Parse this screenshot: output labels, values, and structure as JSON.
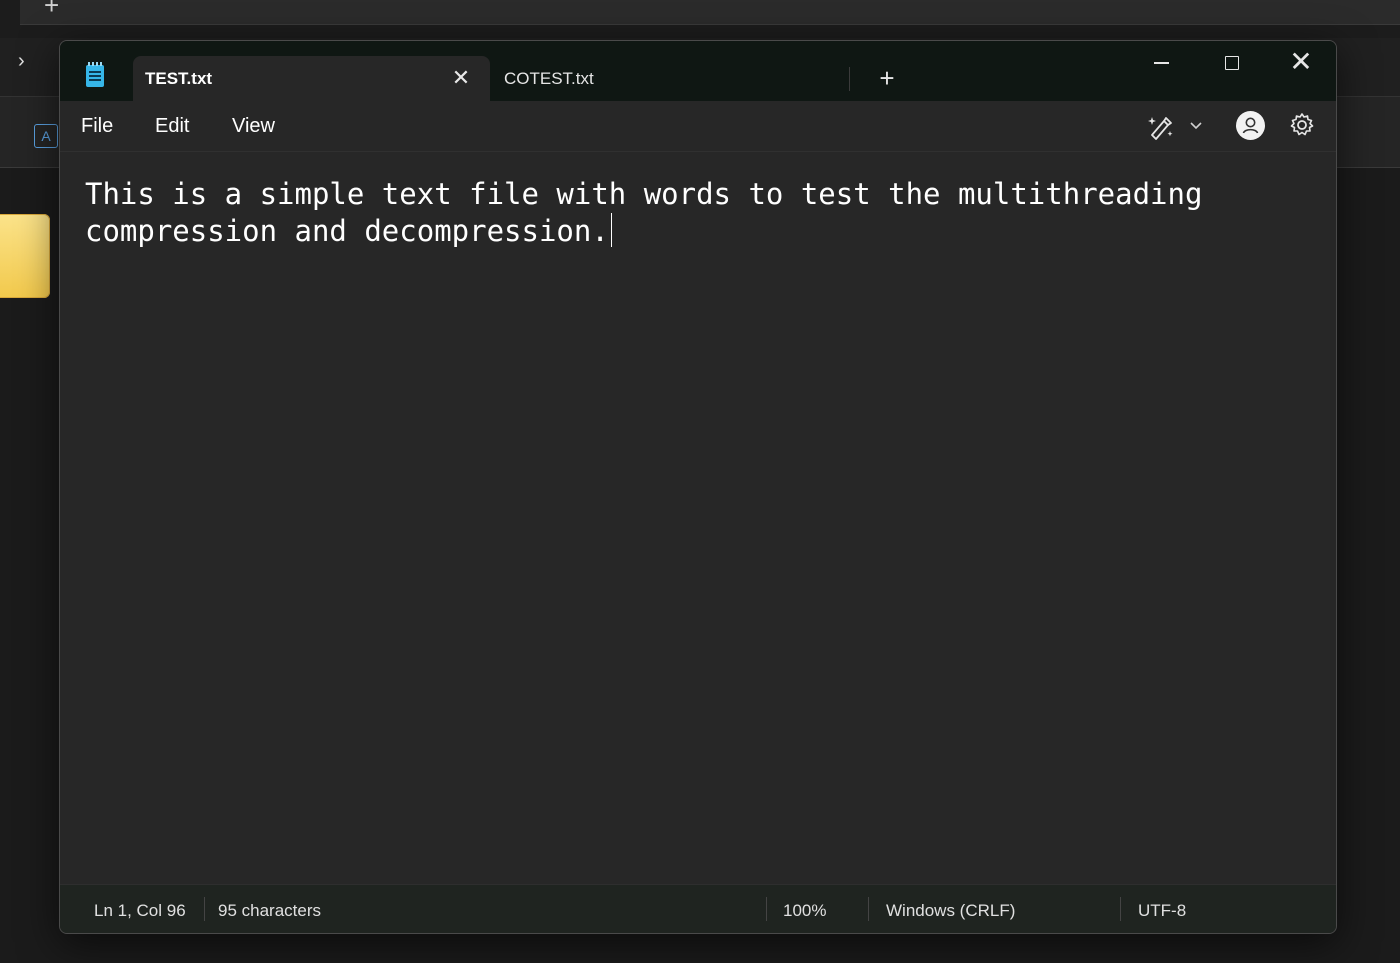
{
  "tabs": [
    {
      "label": "TEST.txt",
      "active": true
    },
    {
      "label": "COTEST.txt",
      "active": false
    }
  ],
  "menu": {
    "file": "File",
    "edit": "Edit",
    "view": "View"
  },
  "editor": {
    "content": "This is a simple text file with words to test the multithreading compression and decompression."
  },
  "status": {
    "position": "Ln 1, Col 96",
    "characters": "95 characters",
    "zoom": "100%",
    "line_ending": "Windows (CRLF)",
    "encoding": "UTF-8"
  },
  "icons": {
    "app": "notepad-icon",
    "new_tab": "plus-icon",
    "tab_close": "close-icon",
    "copilot": "copilot-icon",
    "account": "account-icon",
    "settings": "gear-icon"
  },
  "colors": {
    "window_bg": "#272727",
    "titlebar_bg": "#0f1713",
    "accent": "#36b6e8"
  }
}
